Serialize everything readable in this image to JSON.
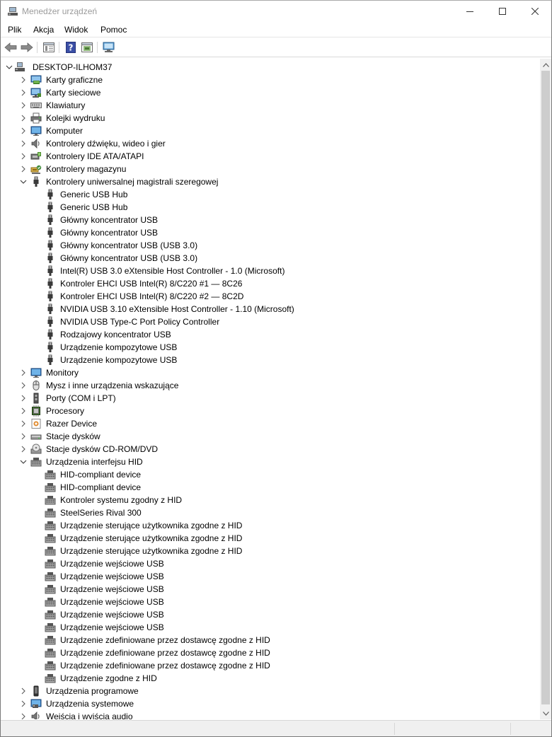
{
  "window": {
    "title": "Menedżer urządzeń"
  },
  "menu": [
    "Plik",
    "Akcja",
    "Widok",
    "Pomoc"
  ],
  "toolbar_icons": [
    "back-arrow-icon",
    "forward-arrow-icon",
    "properties-icon",
    "help-icon",
    "update-driver-icon",
    "scan-hardware-icon"
  ],
  "tree": [
    {
      "label": "DESKTOP-ILHOM37",
      "level": 0,
      "state": "expanded",
      "icon": "computer-tree-root-icon"
    },
    {
      "label": "Karty graficzne",
      "level": 1,
      "state": "collapsed",
      "icon": "display-adapter-icon"
    },
    {
      "label": "Karty sieciowe",
      "level": 1,
      "state": "collapsed",
      "icon": "network-adapter-icon"
    },
    {
      "label": "Klawiatury",
      "level": 1,
      "state": "collapsed",
      "icon": "keyboard-icon"
    },
    {
      "label": "Kolejki wydruku",
      "level": 1,
      "state": "collapsed",
      "icon": "printer-icon"
    },
    {
      "label": "Komputer",
      "level": 1,
      "state": "collapsed",
      "icon": "monitor-icon"
    },
    {
      "label": "Kontrolery dźwięku, wideo i gier",
      "level": 1,
      "state": "collapsed",
      "icon": "speaker-icon"
    },
    {
      "label": "Kontrolery IDE ATA/ATAPI",
      "level": 1,
      "state": "collapsed",
      "icon": "ide-controller-icon"
    },
    {
      "label": "Kontrolery magazynu",
      "level": 1,
      "state": "collapsed",
      "icon": "storage-controller-icon"
    },
    {
      "label": "Kontrolery uniwersalnej magistrali szeregowej",
      "level": 1,
      "state": "expanded",
      "icon": "usb-plug-icon"
    },
    {
      "label": "Generic USB Hub",
      "level": 2,
      "state": "leaf",
      "icon": "usb-plug-icon"
    },
    {
      "label": "Generic USB Hub",
      "level": 2,
      "state": "leaf",
      "icon": "usb-plug-icon"
    },
    {
      "label": "Główny koncentrator USB",
      "level": 2,
      "state": "leaf",
      "icon": "usb-plug-icon"
    },
    {
      "label": "Główny koncentrator USB",
      "level": 2,
      "state": "leaf",
      "icon": "usb-plug-icon"
    },
    {
      "label": "Główny koncentrator USB (USB 3.0)",
      "level": 2,
      "state": "leaf",
      "icon": "usb-plug-icon"
    },
    {
      "label": "Główny koncentrator USB (USB 3.0)",
      "level": 2,
      "state": "leaf",
      "icon": "usb-plug-icon"
    },
    {
      "label": "Intel(R) USB 3.0 eXtensible Host Controller - 1.0 (Microsoft)",
      "level": 2,
      "state": "leaf",
      "icon": "usb-plug-icon"
    },
    {
      "label": "Kontroler EHCI USB Intel(R) 8/C220 #1 — 8C26",
      "level": 2,
      "state": "leaf",
      "icon": "usb-plug-icon"
    },
    {
      "label": "Kontroler EHCI USB Intel(R) 8/C220 #2 — 8C2D",
      "level": 2,
      "state": "leaf",
      "icon": "usb-plug-icon"
    },
    {
      "label": "NVIDIA USB 3.10 eXtensible Host Controller - 1.10 (Microsoft)",
      "level": 2,
      "state": "leaf",
      "icon": "usb-plug-icon"
    },
    {
      "label": "NVIDIA USB Type-C Port Policy Controller",
      "level": 2,
      "state": "leaf",
      "icon": "usb-plug-icon"
    },
    {
      "label": "Rodzajowy koncentrator USB",
      "level": 2,
      "state": "leaf",
      "icon": "usb-plug-icon"
    },
    {
      "label": "Urządzenie kompozytowe USB",
      "level": 2,
      "state": "leaf",
      "icon": "usb-plug-icon"
    },
    {
      "label": "Urządzenie kompozytowe USB",
      "level": 2,
      "state": "leaf",
      "icon": "usb-plug-icon"
    },
    {
      "label": "Monitory",
      "level": 1,
      "state": "collapsed",
      "icon": "monitor-icon"
    },
    {
      "label": "Mysz i inne urządzenia wskazujące",
      "level": 1,
      "state": "collapsed",
      "icon": "mouse-icon"
    },
    {
      "label": "Porty (COM i LPT)",
      "level": 1,
      "state": "collapsed",
      "icon": "port-icon"
    },
    {
      "label": "Procesory",
      "level": 1,
      "state": "collapsed",
      "icon": "processor-icon"
    },
    {
      "label": "Razer Device",
      "level": 1,
      "state": "collapsed",
      "icon": "razer-device-icon"
    },
    {
      "label": "Stacje dysków",
      "level": 1,
      "state": "collapsed",
      "icon": "disk-drive-icon"
    },
    {
      "label": "Stacje dysków CD-ROM/DVD",
      "level": 1,
      "state": "collapsed",
      "icon": "dvd-drive-icon"
    },
    {
      "label": "Urządzenia interfejsu HID",
      "level": 1,
      "state": "expanded",
      "icon": "hid-icon"
    },
    {
      "label": "HID-compliant device",
      "level": 2,
      "state": "leaf",
      "icon": "hid-icon"
    },
    {
      "label": "HID-compliant device",
      "level": 2,
      "state": "leaf",
      "icon": "hid-icon"
    },
    {
      "label": "Kontroler systemu zgodny z HID",
      "level": 2,
      "state": "leaf",
      "icon": "hid-icon"
    },
    {
      "label": "SteelSeries Rival 300",
      "level": 2,
      "state": "leaf",
      "icon": "hid-icon"
    },
    {
      "label": "Urządzenie sterujące użytkownika zgodne z HID",
      "level": 2,
      "state": "leaf",
      "icon": "hid-icon"
    },
    {
      "label": "Urządzenie sterujące użytkownika zgodne z HID",
      "level": 2,
      "state": "leaf",
      "icon": "hid-icon"
    },
    {
      "label": "Urządzenie sterujące użytkownika zgodne z HID",
      "level": 2,
      "state": "leaf",
      "icon": "hid-icon"
    },
    {
      "label": "Urządzenie wejściowe USB",
      "level": 2,
      "state": "leaf",
      "icon": "hid-icon"
    },
    {
      "label": "Urządzenie wejściowe USB",
      "level": 2,
      "state": "leaf",
      "icon": "hid-icon"
    },
    {
      "label": "Urządzenie wejściowe USB",
      "level": 2,
      "state": "leaf",
      "icon": "hid-icon"
    },
    {
      "label": "Urządzenie wejściowe USB",
      "level": 2,
      "state": "leaf",
      "icon": "hid-icon"
    },
    {
      "label": "Urządzenie wejściowe USB",
      "level": 2,
      "state": "leaf",
      "icon": "hid-icon"
    },
    {
      "label": "Urządzenie wejściowe USB",
      "level": 2,
      "state": "leaf",
      "icon": "hid-icon"
    },
    {
      "label": "Urządzenie zdefiniowane przez dostawcę zgodne z HID",
      "level": 2,
      "state": "leaf",
      "icon": "hid-icon"
    },
    {
      "label": "Urządzenie zdefiniowane przez dostawcę zgodne z HID",
      "level": 2,
      "state": "leaf",
      "icon": "hid-icon"
    },
    {
      "label": "Urządzenie zdefiniowane przez dostawcę zgodne z HID",
      "level": 2,
      "state": "leaf",
      "icon": "hid-icon"
    },
    {
      "label": "Urządzenie zgodne z HID",
      "level": 2,
      "state": "leaf",
      "icon": "hid-icon"
    },
    {
      "label": "Urządzenia programowe",
      "level": 1,
      "state": "collapsed",
      "icon": "software-device-icon"
    },
    {
      "label": "Urządzenia systemowe",
      "level": 1,
      "state": "collapsed",
      "icon": "system-device-icon"
    },
    {
      "label": "Wejścia i wyjścia audio",
      "level": 1,
      "state": "collapsed",
      "icon": "audio-io-icon"
    }
  ]
}
